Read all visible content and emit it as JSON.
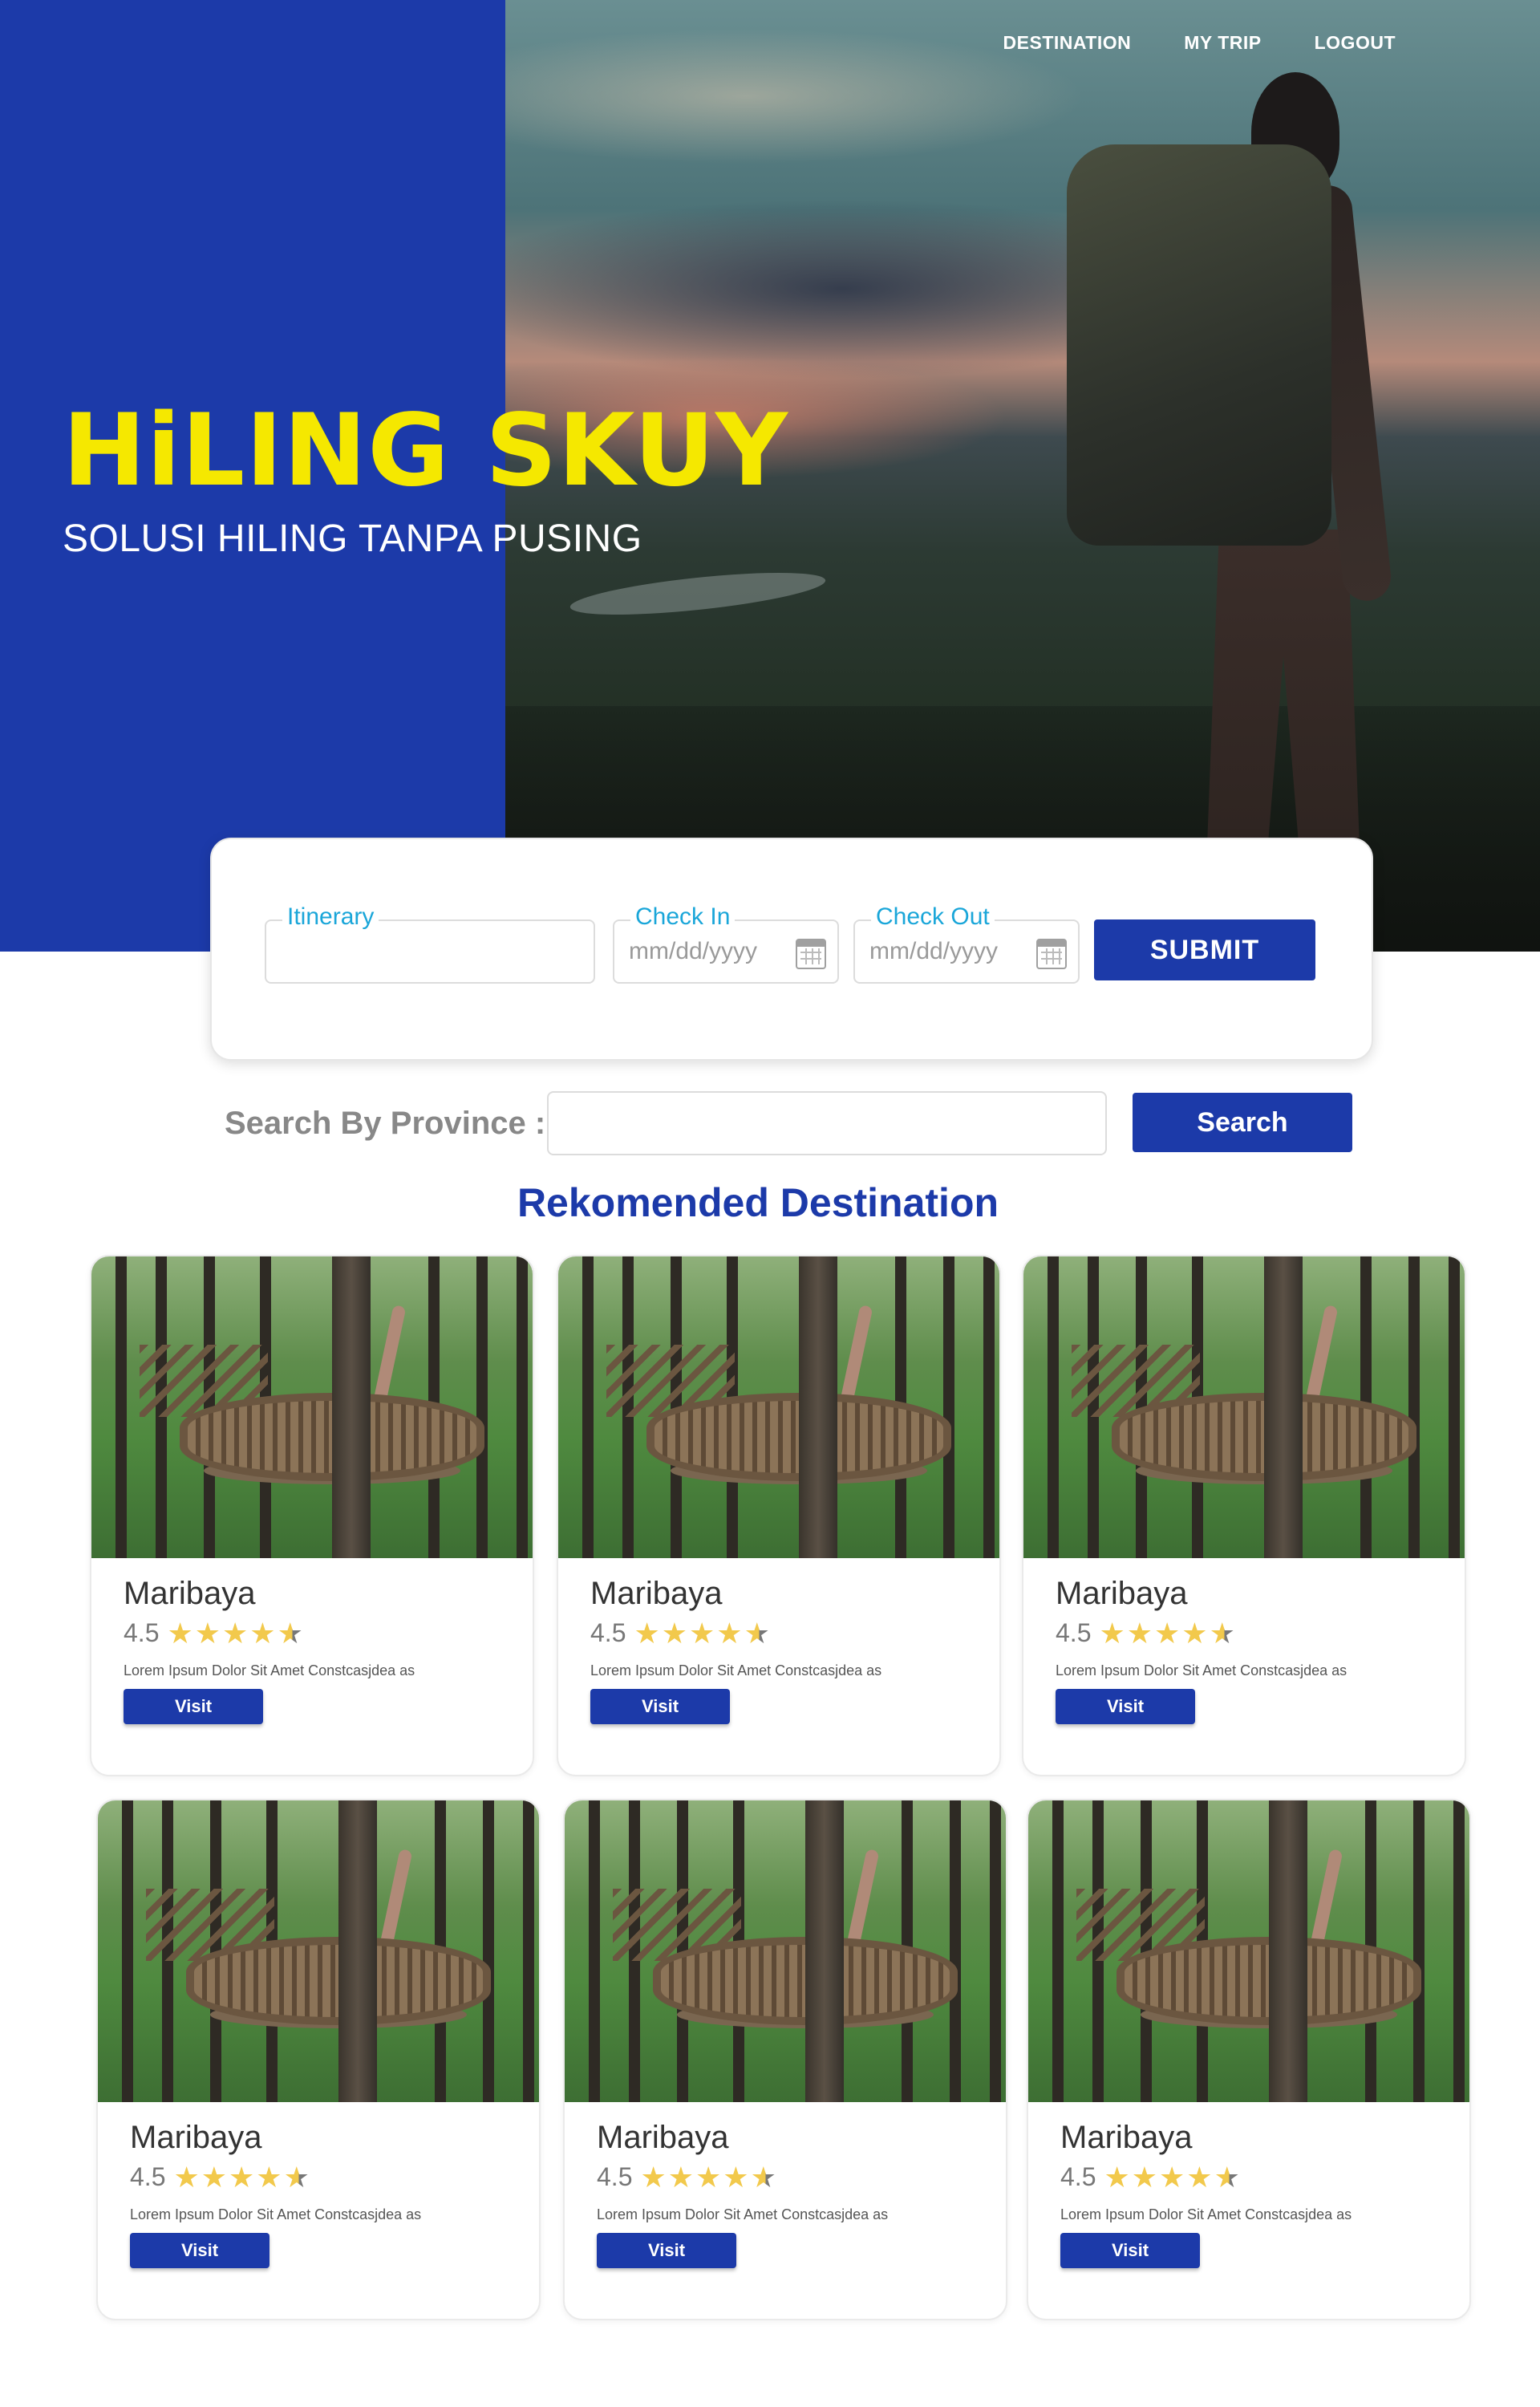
{
  "nav": {
    "items": [
      {
        "label": "DESTINATION"
      },
      {
        "label": "MY TRIP"
      },
      {
        "label": "LOGOUT"
      }
    ]
  },
  "hero": {
    "title": "HiLING SKUY",
    "subtitle": "SOLUSI HILING TANPA PUSING",
    "colors": {
      "panel": "#1c3aa9",
      "title": "#f5e800"
    }
  },
  "booking": {
    "itinerary_label": "Itinerary",
    "itinerary_value": "",
    "checkin_label": "Check In",
    "checkin_placeholder": "mm/dd/yyyy",
    "checkout_label": "Check Out",
    "checkout_placeholder": "mm/dd/yyyy",
    "calendar_icon": "calendar-icon",
    "submit_label": "SUBMIT"
  },
  "search": {
    "label": "Search By Province :",
    "value": "",
    "button_label": "Search"
  },
  "recommended": {
    "title": "Rekomended Destination",
    "cards": [
      {
        "name": "Maribaya",
        "rating": "4.5",
        "stars": "★★★★",
        "half_star": "★",
        "description": "Lorem Ipsum Dolor Sit Amet Constcasjdea as",
        "button": "Visit"
      },
      {
        "name": "Maribaya",
        "rating": "4.5",
        "stars": "★★★★",
        "half_star": "★",
        "description": "Lorem Ipsum Dolor Sit Amet Constcasjdea as",
        "button": "Visit"
      },
      {
        "name": "Maribaya",
        "rating": "4.5",
        "stars": "★★★★",
        "half_star": "★",
        "description": "Lorem Ipsum Dolor Sit Amet Constcasjdea as",
        "button": "Visit"
      },
      {
        "name": "Maribaya",
        "rating": "4.5",
        "stars": "★★★★",
        "half_star": "★",
        "description": "Lorem Ipsum Dolor Sit Amet Constcasjdea as",
        "button": "Visit"
      },
      {
        "name": "Maribaya",
        "rating": "4.5",
        "stars": "★★★★",
        "half_star": "★",
        "description": "Lorem Ipsum Dolor Sit Amet Constcasjdea as",
        "button": "Visit"
      },
      {
        "name": "Maribaya",
        "rating": "4.5",
        "stars": "★★★★",
        "half_star": "★",
        "description": "Lorem Ipsum Dolor Sit Amet Constcasjdea as",
        "button": "Visit"
      }
    ]
  },
  "colors": {
    "accent": "#1c3aa9",
    "label_blue": "#1aa6d9",
    "star": "#f2c94c"
  }
}
